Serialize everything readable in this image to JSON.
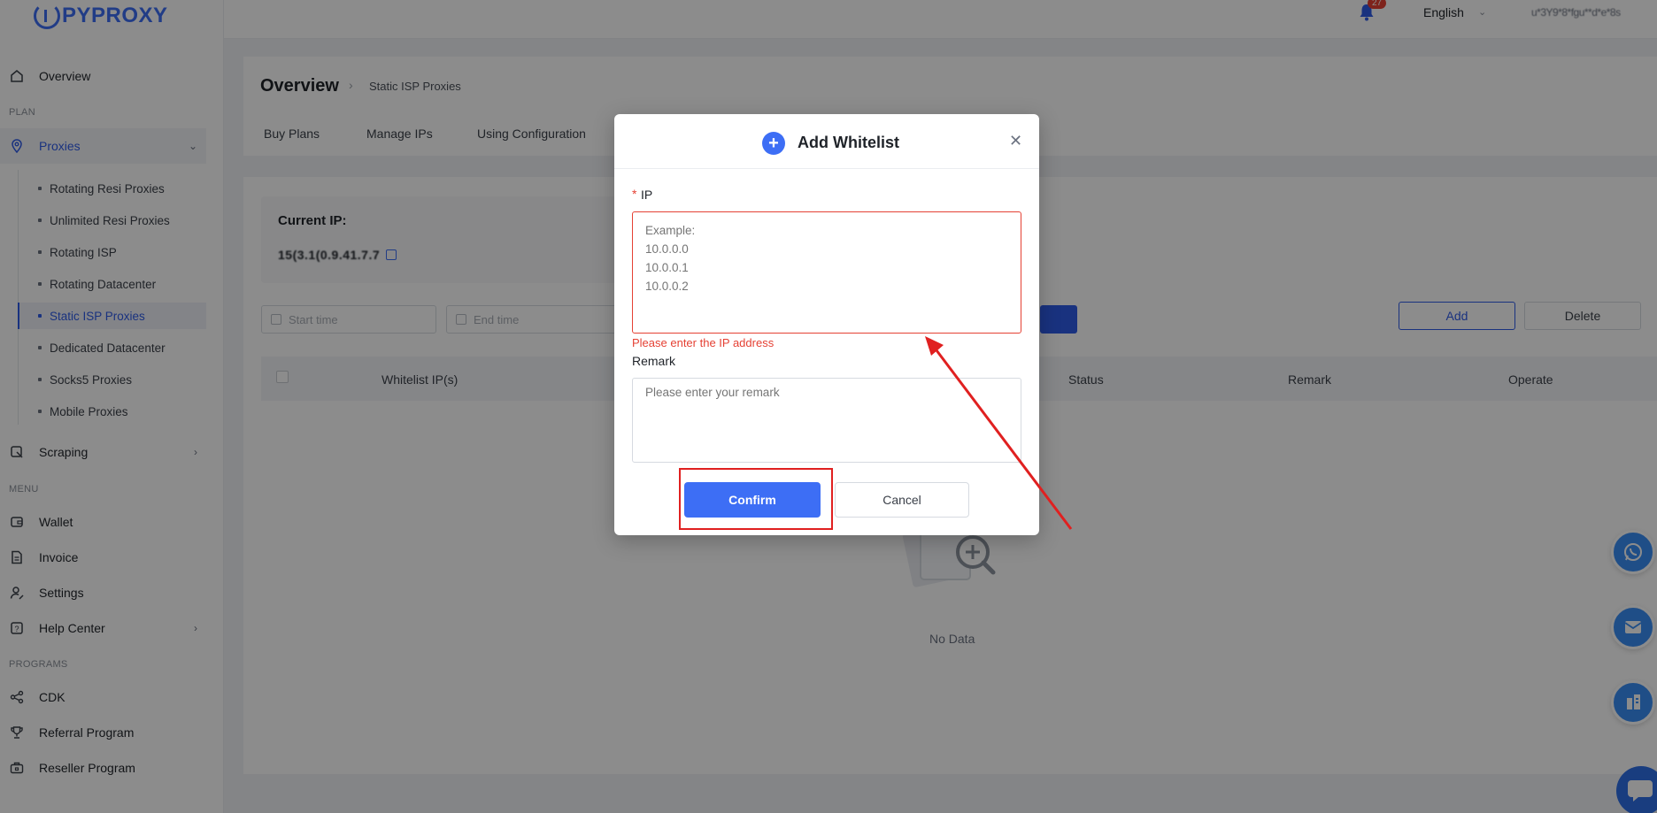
{
  "brand": {
    "logo_text": "PYPROXY",
    "accent": "#3d6ef5"
  },
  "header": {
    "notification_count": "27",
    "language": "English",
    "username": "u*3Y9*8*fgu**d*e*8s"
  },
  "sidebar": {
    "overview": "Overview",
    "plan_title": "PLAN",
    "proxies": "Proxies",
    "proxy_items": [
      "Rotating Resi Proxies",
      "Unlimited Resi Proxies",
      "Rotating ISP",
      "Rotating Datacenter",
      "Static ISP Proxies",
      "Dedicated Datacenter",
      "Socks5 Proxies",
      "Mobile Proxies"
    ],
    "active_proxy_item": "Static ISP Proxies",
    "scraping": "Scraping",
    "menu_title": "MENU",
    "wallet": "Wallet",
    "invoice": "Invoice",
    "settings": "Settings",
    "help_center": "Help Center",
    "programs_title": "PROGRAMS",
    "cdk": "CDK",
    "referral": "Referral Program",
    "reseller": "Reseller Program"
  },
  "page": {
    "title": "Overview",
    "breadcrumb": "Static ISP Proxies",
    "tabs": [
      "Buy Plans",
      "Manage IPs",
      "Using Configuration"
    ],
    "current_ip_label": "Current IP:",
    "current_ip_value": "15(3.1(0.9.41.7.7",
    "start_time_placeholder": "Start time",
    "end_time_placeholder": "End time",
    "add_label": "Add",
    "delete_label": "Delete",
    "table_headers": [
      "Whitelist IP(s)",
      "Status",
      "Remark",
      "Operate"
    ],
    "empty_text": "No Data"
  },
  "modal": {
    "title": "Add Whitelist",
    "ip_label": "IP",
    "required_mark": "*",
    "ip_placeholder": "Example:\n10.0.0.0\n10.0.0.1\n10.0.0.2",
    "ip_error": "Please enter the IP address",
    "remark_label": "Remark",
    "remark_placeholder": "Please enter your remark",
    "confirm_label": "Confirm",
    "cancel_label": "Cancel"
  },
  "colors": {
    "error": "#e54134",
    "annotation": "#e02020",
    "primary": "#2f5be8"
  }
}
